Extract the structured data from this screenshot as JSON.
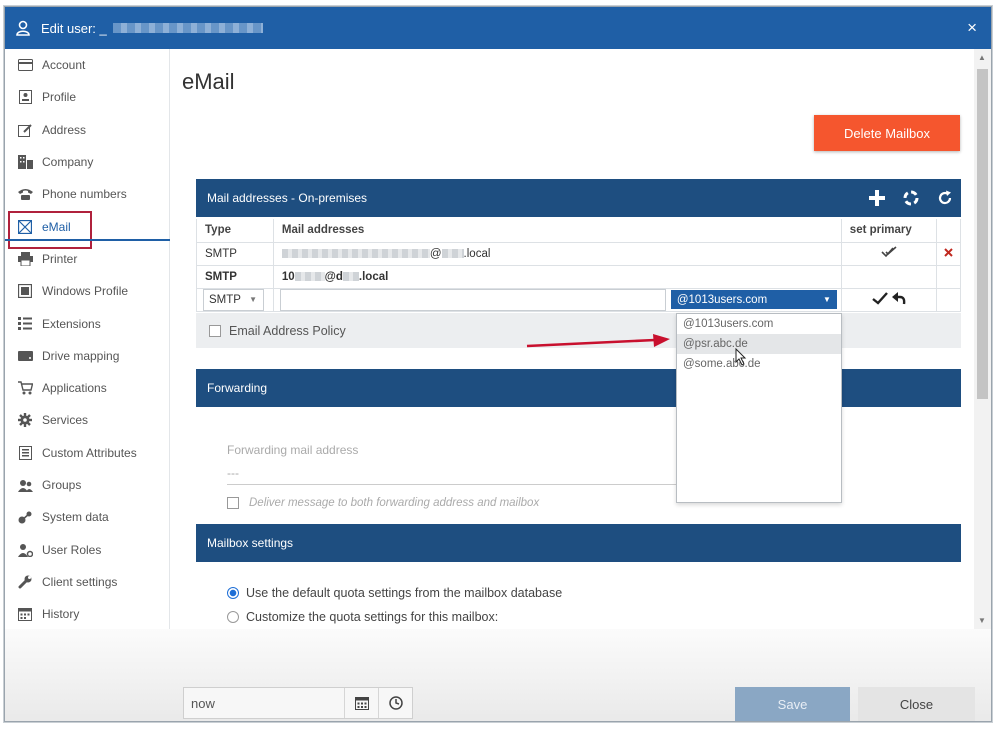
{
  "window": {
    "title": "Edit user: _",
    "close_label": "×"
  },
  "sidebar": {
    "items": [
      {
        "label": "Account",
        "icon": "card-icon"
      },
      {
        "label": "Profile",
        "icon": "id-badge-icon"
      },
      {
        "label": "Address",
        "icon": "edit-icon"
      },
      {
        "label": "Company",
        "icon": "building-icon"
      },
      {
        "label": "Phone numbers",
        "icon": "phone-icon"
      },
      {
        "label": "eMail",
        "icon": "envelope-icon",
        "active": true
      },
      {
        "label": "Printer",
        "icon": "printer-icon"
      },
      {
        "label": "Windows Profile",
        "icon": "window-icon"
      },
      {
        "label": "Extensions",
        "icon": "list-icon"
      },
      {
        "label": "Drive mapping",
        "icon": "drive-icon"
      },
      {
        "label": "Applications",
        "icon": "cart-icon"
      },
      {
        "label": "Services",
        "icon": "gear-icon"
      },
      {
        "label": "Custom Attributes",
        "icon": "document-icon"
      },
      {
        "label": "Groups",
        "icon": "users-icon"
      },
      {
        "label": "System data",
        "icon": "network-icon"
      },
      {
        "label": "User Roles",
        "icon": "user-gear-icon"
      },
      {
        "label": "Client settings",
        "icon": "wrench-icon"
      },
      {
        "label": "History",
        "icon": "calendar-icon"
      }
    ]
  },
  "main": {
    "title": "eMail",
    "delete_button": "Delete Mailbox",
    "mail_panel": {
      "title": "Mail addresses - On-premises",
      "columns": {
        "type": "Type",
        "addresses": "Mail addresses",
        "primary": "set primary"
      },
      "rows": [
        {
          "type": "SMTP",
          "address_suffix": ".local"
        },
        {
          "type": "SMTP",
          "address_prefix": "10",
          "address_mid": "@d",
          "address_suffix": ".local",
          "primary": true
        }
      ],
      "new_row": {
        "type": "SMTP",
        "domain": "@1013users.com"
      },
      "policy_label": "Email Address Policy"
    },
    "domain_dropdown": {
      "options": [
        "@1013users.com",
        "@psr.abc.de",
        "@some.abc.de"
      ],
      "hovered_index": 1
    },
    "forwarding": {
      "title": "Forwarding",
      "field_label": "Forwarding mail address",
      "field_value": "---",
      "deliver_both_label": "Deliver message to both forwarding address and mailbox"
    },
    "mailbox_settings": {
      "title": "Mailbox settings",
      "options": [
        {
          "label": "Use the default quota settings from the mailbox database",
          "selected": true
        },
        {
          "label": "Customize the quota settings for this mailbox:",
          "selected": false
        }
      ]
    }
  },
  "footer": {
    "date_value": "now",
    "save_label": "Save",
    "close_label": "Close"
  },
  "colors": {
    "titlebar": "#1f5fa6",
    "panel_header": "#1e4e80",
    "delete_button": "#f5562e",
    "save_button": "#8aa7c4",
    "highlight_border": "#b0213c",
    "arrow": "#c8102e"
  }
}
